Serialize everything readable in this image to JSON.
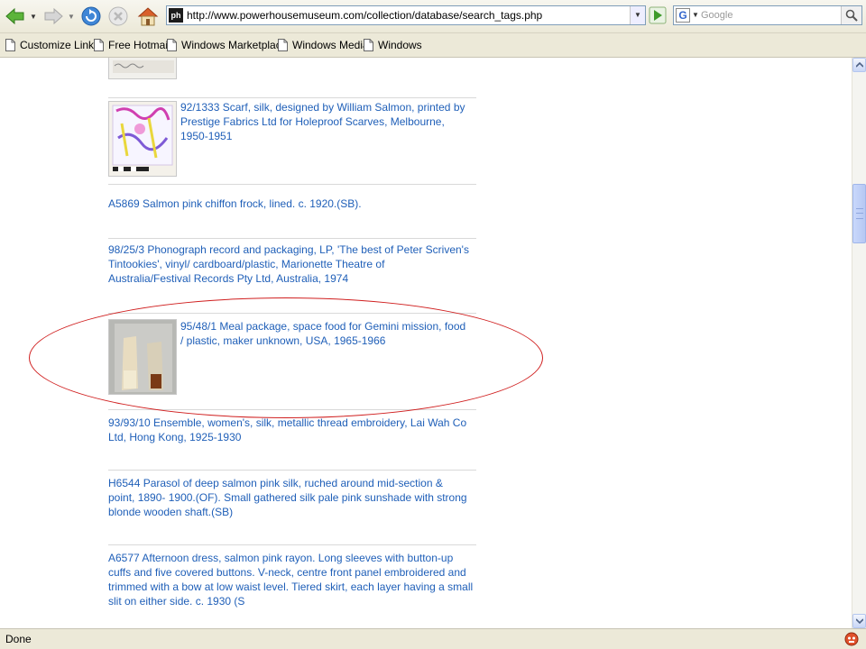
{
  "browser": {
    "url": "http://www.powerhousemuseum.com/collection/database/search_tags.php",
    "site_icon_text": "ph",
    "search_placeholder": "Google",
    "search_engine_letter": "G",
    "status_text": "Done"
  },
  "links_bar": [
    {
      "label": "Customize Links"
    },
    {
      "label": "Free Hotmail"
    },
    {
      "label": "Windows Marketplace"
    },
    {
      "label": "Windows Media"
    },
    {
      "label": "Windows"
    }
  ],
  "results": [
    {
      "text": "92/1333 Scarf, silk, designed by William Salmon, printed by Prestige Fabrics Ltd for Holeproof Scarves, Melbourne, 1950-1951",
      "has_thumbnail": true
    },
    {
      "text": "A5869 Salmon pink chiffon frock, lined. c. 1920.(SB).",
      "has_thumbnail": false
    },
    {
      "text": "98/25/3 Phonograph record and packaging, LP, 'The best of Peter Scriven's Tintookies', vinyl/ cardboard/plastic, Marionette Theatre of Australia/Festival Records Pty Ltd, Australia, 1974",
      "has_thumbnail": false
    },
    {
      "text": "95/48/1 Meal package, space food for Gemini mission, food / plastic, maker unknown, USA, 1965-1966",
      "has_thumbnail": true,
      "highlighted": true
    },
    {
      "text": "93/93/10 Ensemble, women's, silk, metallic thread embroidery, Lai Wah Co Ltd, Hong Kong, 1925-1930",
      "has_thumbnail": false
    },
    {
      "text": "H6544 Parasol of deep salmon pink silk, ruched around mid-section & point, 1890- 1900.(OF). Small gathered silk pale pink sunshade with strong blonde wooden shaft.(SB)",
      "has_thumbnail": false
    },
    {
      "text": "A6577 Afternoon dress, salmon pink rayon. Long sleeves with button-up cuffs and five covered buttons. V-neck, centre front panel embroidered and trimmed with a bow at low waist level. Tiered skirt, each layer having a small slit on either side. c. 1930 (S",
      "has_thumbnail": false
    }
  ],
  "colors": {
    "link": "#1f5fb8",
    "highlight_ellipse": "#d01f1f",
    "toolbar_bg": "#ece9d8"
  },
  "icons": [
    "back-arrow-icon",
    "forward-arrow-icon",
    "reload-icon",
    "stop-icon",
    "home-icon",
    "go-arrow-icon",
    "search-magnifier-icon",
    "page-icon",
    "status-popup-blocker-icon"
  ]
}
